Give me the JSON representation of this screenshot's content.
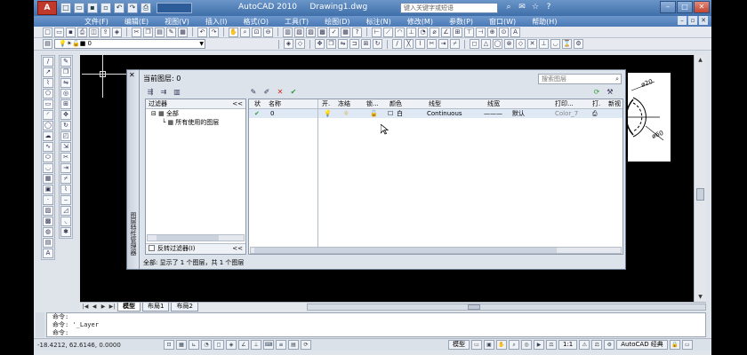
{
  "window": {
    "app_title": "AutoCAD 2010",
    "doc_title": "Drawing1.dwg",
    "search_placeholder": "键入关键字或短语",
    "logo": "A"
  },
  "menus": [
    "文件(F)",
    "编辑(E)",
    "视图(V)",
    "插入(I)",
    "格式(O)",
    "工具(T)",
    "绘图(D)",
    "标注(N)",
    "修改(M)",
    "参数(P)",
    "窗口(W)",
    "帮助(H)"
  ],
  "layer_toolbar": {
    "current_layer": "0"
  },
  "layer_dialog": {
    "current_layer_label": "当前图层: 0",
    "search_placeholder": "搜索图层",
    "side_title": "图层特性管理器",
    "filter_header": "过滤器",
    "filter_collapse": "<<",
    "tree": [
      {
        "label": "全部",
        "level": 1
      },
      {
        "label": "所有使用的图层",
        "level": 2
      }
    ],
    "invert_filter_label": "反转过滤器(I)",
    "columns": [
      "状",
      "名称",
      "开.",
      "冻结",
      "锁...",
      "颜色",
      "线型",
      "线宽",
      "打印...",
      "打.",
      "新视"
    ],
    "layers": [
      {
        "status": "✔",
        "name": "0",
        "color_name": "白",
        "linetype": "Continuous",
        "lineweight": "默认",
        "plot_style": "Color_7"
      }
    ],
    "status_text": "全部: 显示了 1 个图层，共 1 个图层"
  },
  "drawing": {
    "dim_labels": [
      "ø20",
      "ø60"
    ]
  },
  "tabs": [
    "模型",
    "布局1",
    "布局2"
  ],
  "command_lines": [
    "命令:",
    "命令: '_Layer",
    "命令:"
  ],
  "status_bar": {
    "coords": "-18.4212, 62.6146, 0.0000",
    "model_label": "模型",
    "scale": "1:1",
    "workspace": "AutoCAD 经典"
  },
  "colors": {
    "title_bar": "#3f6fa9",
    "canvas": "#000000",
    "current_check": "#2e9b3a",
    "delete_red": "#cc2222"
  }
}
